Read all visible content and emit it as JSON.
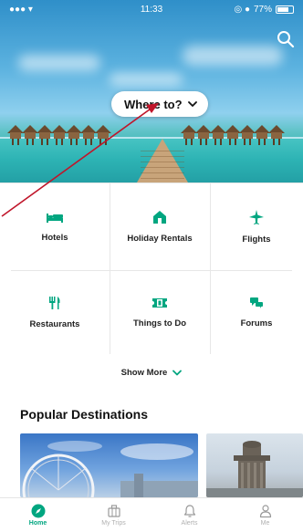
{
  "status_bar": {
    "signal": "●●● ▾",
    "time": "11:33",
    "battery_percent": "77%",
    "indicators": "◎ ●"
  },
  "header": {
    "search_icon": "search-icon",
    "where_to_label": "Where to?"
  },
  "categories": [
    {
      "label": "Hotels",
      "icon": "bed-icon"
    },
    {
      "label": "Holiday Rentals",
      "icon": "house-icon"
    },
    {
      "label": "Flights",
      "icon": "plane-icon"
    },
    {
      "label": "Restaurants",
      "icon": "fork-knife-icon"
    },
    {
      "label": "Things to Do",
      "icon": "ticket-icon"
    },
    {
      "label": "Forums",
      "icon": "chat-bubbles-icon"
    }
  ],
  "show_more_label": "Show More",
  "popular_destinations": {
    "title": "Popular Destinations"
  },
  "tabbar": {
    "items": [
      {
        "label": "Home",
        "icon": "compass-icon",
        "active": true
      },
      {
        "label": "My Trips",
        "icon": "suitcase-icon",
        "active": false
      },
      {
        "label": "Alerts",
        "icon": "bell-icon",
        "active": false
      },
      {
        "label": "Me",
        "icon": "person-icon",
        "active": false
      }
    ]
  },
  "colors": {
    "accent": "#00a680",
    "annotation_arrow": "#c0152a"
  }
}
